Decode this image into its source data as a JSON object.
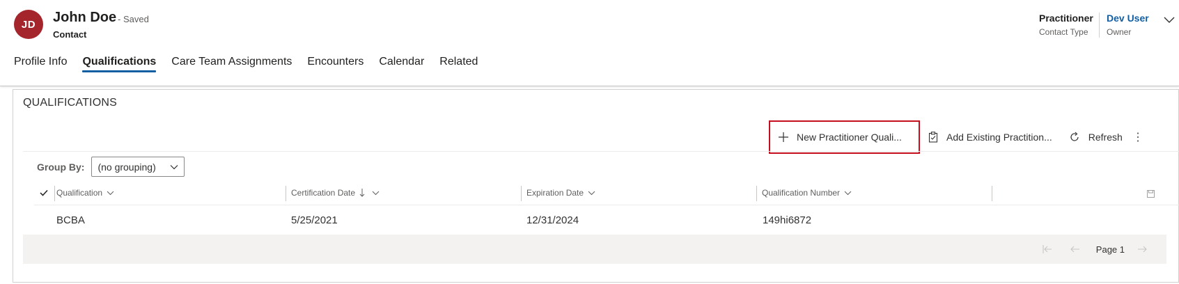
{
  "record": {
    "avatar_initials": "JD",
    "avatar_color": "#a4262c",
    "name": "John Doe",
    "save_status": "- Saved",
    "entity": "Contact"
  },
  "header_fields": {
    "contact_type_value": "Practitioner",
    "contact_type_label": "Contact Type",
    "owner_value": "Dev User",
    "owner_label": "Owner"
  },
  "tabs": [
    {
      "label": "Profile Info",
      "active": false
    },
    {
      "label": "Qualifications",
      "active": true
    },
    {
      "label": "Care Team Assignments",
      "active": false
    },
    {
      "label": "Encounters",
      "active": false
    },
    {
      "label": "Calendar",
      "active": false
    },
    {
      "label": "Related",
      "active": false
    }
  ],
  "section": {
    "title": "QUALIFICATIONS"
  },
  "commands": {
    "new_label": "New Practitioner Quali...",
    "add_existing_label": "Add Existing Practition...",
    "refresh_label": "Refresh",
    "more_icon": "more-vertical-icon"
  },
  "group_by": {
    "label": "Group By:",
    "selected": "(no grouping)"
  },
  "grid": {
    "columns": [
      "Qualification",
      "Certification Date",
      "Expiration Date",
      "Qualification Number"
    ],
    "sort_column": "Certification Date",
    "rows": [
      [
        "BCBA",
        "5/25/2021",
        "12/31/2024",
        "149hi6872"
      ]
    ]
  },
  "pager": {
    "page_label": "Page 1"
  },
  "colors": {
    "accent": "#115ea3",
    "highlight_border": "#c50f1f",
    "footer_bg": "#f3f2f1"
  }
}
